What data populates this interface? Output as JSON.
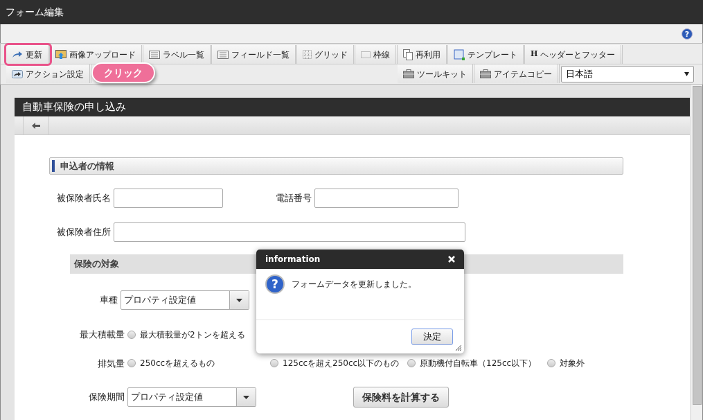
{
  "window": {
    "title": "フォーム編集"
  },
  "help": {
    "icon_text": "?"
  },
  "toolbar": {
    "row1": [
      {
        "kind": "update",
        "label": "更新",
        "highlighted": true
      },
      {
        "kind": "image",
        "label": "画像アップロード",
        "highlighted": false
      },
      {
        "kind": "list",
        "label": "ラベル一覧",
        "highlighted": false
      },
      {
        "kind": "list",
        "label": "フィールド一覧",
        "highlighted": false
      },
      {
        "kind": "grid",
        "label": "グリッド",
        "highlighted": false
      },
      {
        "kind": "border",
        "label": "枠線",
        "highlighted": false
      },
      {
        "kind": "copy",
        "label": "再利用",
        "highlighted": false
      },
      {
        "kind": "template",
        "label": "テンプレート",
        "highlighted": false
      },
      {
        "kind": "header",
        "icon_text": "H",
        "label": "ヘッダーとフッター",
        "highlighted": false
      }
    ],
    "row2_left": [
      {
        "kind": "action",
        "label": "アクション設定",
        "highlighted": false
      }
    ],
    "row2_right": [
      {
        "kind": "toolkit",
        "label": "ツールキット",
        "highlighted": false
      },
      {
        "kind": "toolkit",
        "label": "アイテムコピー",
        "highlighted": false
      }
    ],
    "language": {
      "value": "日本語"
    }
  },
  "callout": {
    "text": "クリック"
  },
  "form": {
    "title": "自動車保険の申し込み",
    "section1": {
      "title": "申込者の情報"
    },
    "name_label": "被保険者氏名",
    "phone_label": "電話番号",
    "address_label": "被保険者住所",
    "section2": {
      "title": "保険の対象"
    },
    "vehicle": {
      "label": "車種",
      "value": "プロパティ設定値"
    },
    "load": {
      "label": "最大積載量",
      "options": [
        {
          "label": "最大積載量が2トンを超える",
          "selected": false
        }
      ]
    },
    "displacement": {
      "label": "排気量",
      "options": [
        {
          "label": "250ccを超えるもの",
          "selected": false
        },
        {
          "label": "125ccを超え250cc以下のもの",
          "selected": false
        },
        {
          "label": "原動機付自転車（125cc以下）",
          "selected": false
        },
        {
          "label": "対象外",
          "selected": false
        }
      ]
    },
    "period": {
      "label": "保険期間",
      "value": "プロパティ設定値"
    },
    "calculate_button": "保険料を計算する"
  },
  "dialog": {
    "icon_text": "?",
    "title": "information",
    "message": "フォームデータを更新しました。",
    "button": "決定"
  }
}
